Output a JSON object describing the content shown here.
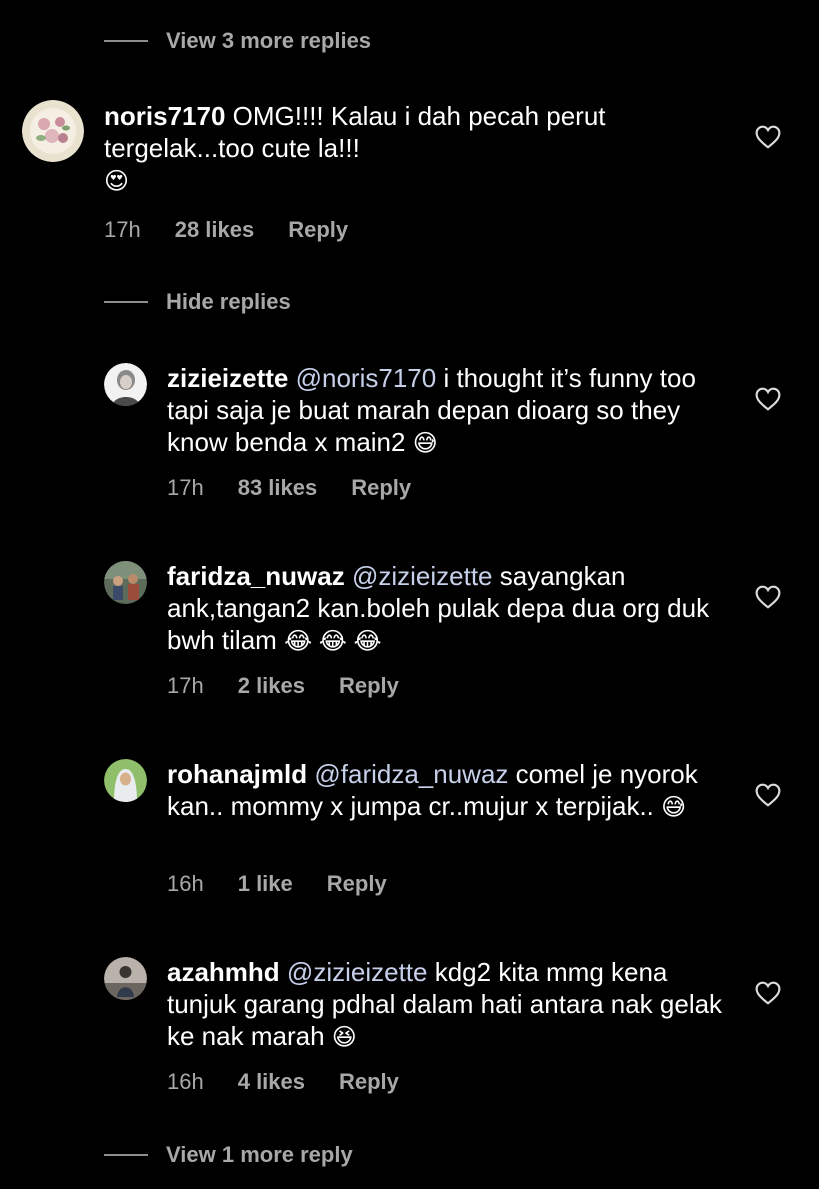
{
  "view_more_top": "View 3 more replies",
  "hide_replies": "Hide replies",
  "view_more_bottom": "View 1 more reply",
  "comments": [
    {
      "username": "noris7170",
      "mention": "",
      "text": "OMG!!!! Kalau i dah pecah perut tergelak...too cute la!!!",
      "emoji": "😍",
      "time": "17h",
      "likes": "28 likes",
      "reply": "Reply"
    },
    {
      "username": "zizieizette",
      "mention": "@noris7170",
      "text": "i thought it’s funny too tapi saja je buat marah depan dioarg so they know benda x main2",
      "emoji": "😅",
      "time": "17h",
      "likes": "83 likes",
      "reply": "Reply"
    },
    {
      "username": "faridza_nuwaz",
      "mention": "@zizieizette",
      "text": "sayangkan ank,tangan2 kan.boleh pulak depa dua org duk bwh tilam",
      "emoji": "😂 😂 😂",
      "time": "17h",
      "likes": "2 likes",
      "reply": "Reply"
    },
    {
      "username": "rohanajmld",
      "mention": "@faridza_nuwaz",
      "text": "comel je nyorok kan.. mommy x jumpa cr..mujur x terpijak..",
      "emoji": "😅",
      "time": "16h",
      "likes": "1 like",
      "reply": "Reply"
    },
    {
      "username": "azahmhd",
      "mention": "@zizieizette",
      "text": "kdg2 kita mmg kena tunjuk garang pdhal dalam hati antara nak gelak ke nak marah",
      "emoji": "😆",
      "time": "16h",
      "likes": "4 likes",
      "reply": "Reply"
    }
  ]
}
